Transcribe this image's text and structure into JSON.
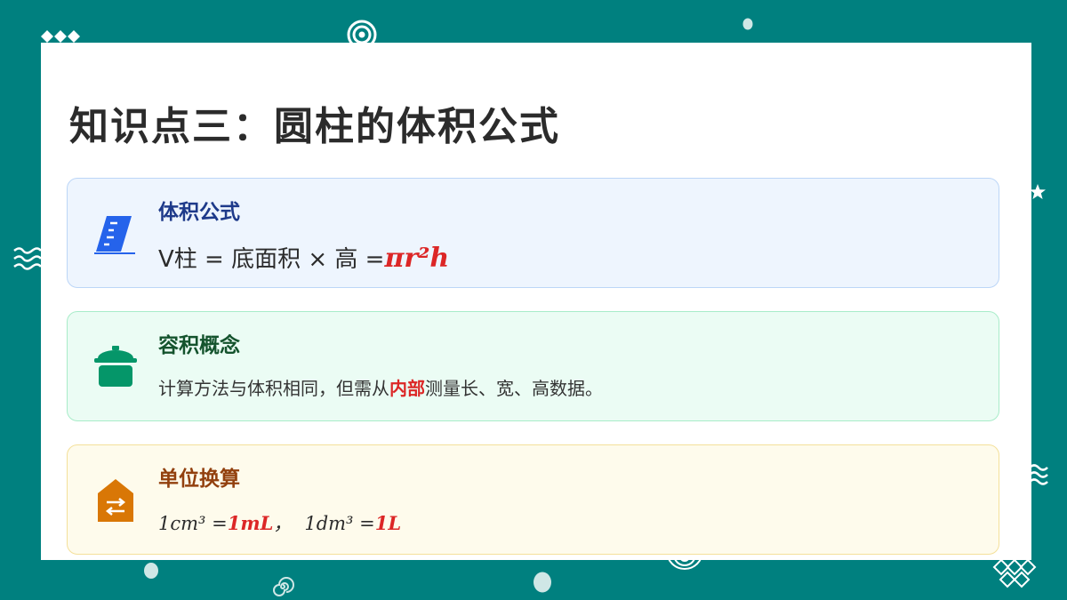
{
  "slide": {
    "title": "知识点三：圆柱的体积公式"
  },
  "cards": [
    {
      "id": "volume-formula",
      "icon": "ruler-icon",
      "color": "#2563eb",
      "title": "体积公式",
      "formula_prefix": "V柱 = 底面积 × 高 =",
      "formula_highlight": "πr²h"
    },
    {
      "id": "capacity-concept",
      "icon": "pot-icon",
      "color": "#059669",
      "title": "容积概念",
      "text_before": "计算方法与体积相同，但需从",
      "text_highlight": "内部",
      "text_after": "测量长、宽、高数据。"
    },
    {
      "id": "unit-conversion",
      "icon": "exchange-tag-icon",
      "color": "#d97706",
      "title": "单位换算",
      "part1_prefix": "1cm³ =",
      "part1_highlight": "1mL",
      "separator": "，",
      "part2_prefix": "1dm³ =",
      "part2_highlight": "1L"
    }
  ],
  "colors": {
    "background": "#00807f",
    "accent_red": "#dc2626"
  }
}
